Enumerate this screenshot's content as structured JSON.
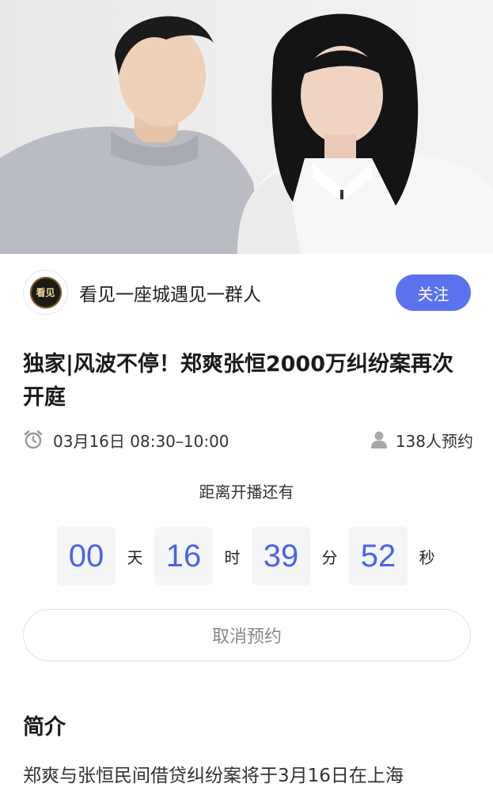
{
  "author": {
    "avatar_text": "看见",
    "name": "看见一座城遇见一群人",
    "follow_label": "关注"
  },
  "title": "独家|风波不停！郑爽张恒2000万纠纷案再次开庭",
  "meta": {
    "time": "03月16日 08:30–10:00",
    "reservations": "138人预约",
    "clock_icon": "alarm-clock-icon",
    "person_icon": "person-icon"
  },
  "countdown": {
    "label": "距离开播还有",
    "days": "00",
    "days_unit": "天",
    "hours": "16",
    "hours_unit": "时",
    "minutes": "39",
    "minutes_unit": "分",
    "seconds": "52",
    "seconds_unit": "秒"
  },
  "cancel_label": "取消预约",
  "intro": {
    "heading": "简介",
    "text": "郑爽与张恒民间借贷纠纷案将于3月16日在上海"
  },
  "colors": {
    "accent": "#5b72ee",
    "countdown_digits": "#4a63e8"
  }
}
